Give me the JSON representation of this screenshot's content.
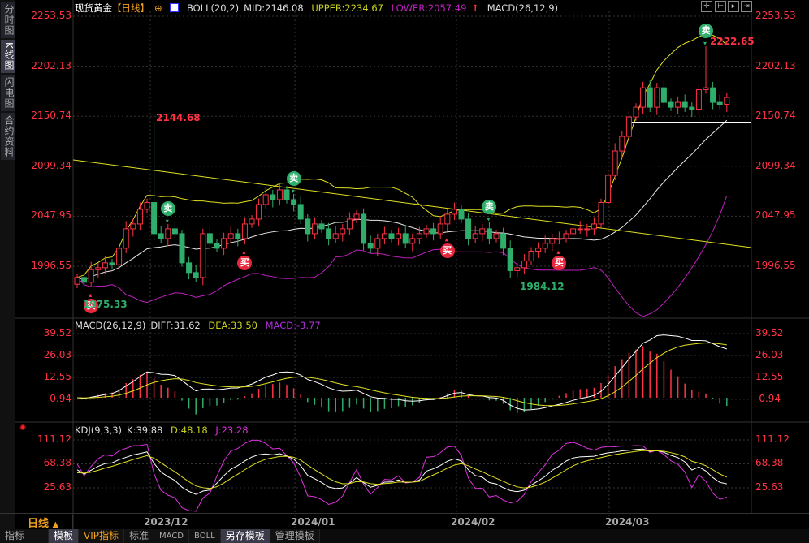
{
  "sidebar": {
    "tabs": [
      {
        "label": "分时图"
      },
      {
        "label": "K线图"
      },
      {
        "label": "闪电图"
      },
      {
        "label": "合约资料"
      }
    ]
  },
  "header": {
    "symbol": "现货黄金",
    "period": "【日线】",
    "boll": "BOLL(20,2)",
    "mid": "MID:2146.08",
    "upper": "UPPER:2234.67",
    "lower": "LOWER:2057.49",
    "macd": "MACD(26,12,9)"
  },
  "macd_legend": {
    "name": "MACD(26,12,9)",
    "diff": "DIFF:31.62",
    "dea": "DEA:33.50",
    "macd": "MACD:-3.77"
  },
  "kdj_legend": {
    "name": "KDJ(9,3,3)",
    "k": "K:39.88",
    "d": "D:48.18",
    "j": "J:23.28"
  },
  "toolbar": {
    "icons": [
      "crosshair-icon",
      "zoom-in-icon",
      "zoom-out-icon",
      "move-right-icon"
    ]
  },
  "annotations": {
    "high": "2144.68",
    "low_start": "1975.33",
    "low_feb": "1984.12",
    "high_mar": "2222.65",
    "sell": "卖",
    "buy": "买"
  },
  "colors": {
    "up": "#ff3344",
    "down": "#2fae6b",
    "boll": "#e0e020",
    "mid": "#e8e8e8",
    "lower": "#c020c0"
  },
  "bottom": {
    "period": "日线",
    "period_icon": "▲",
    "tabs": [
      "指标",
      "模板",
      "VIP指标",
      "标准",
      "MACD",
      "BOLL",
      "另存模板",
      "管理模板"
    ]
  },
  "chart_data": {
    "type": "candlestick",
    "x_ticks": [
      "2023/12",
      "2024/01",
      "2024/02",
      "2024/03"
    ],
    "price_axis": [
      "2253.53",
      "2202.13",
      "2150.74",
      "2099.34",
      "2047.95",
      "1996.55"
    ],
    "macd_axis": [
      "39.52",
      "26.03",
      "12.55",
      "-0.94"
    ],
    "kdj_axis": [
      "111.12",
      "68.38",
      "25.63"
    ],
    "closes": [
      1985,
      1980,
      1993,
      1995,
      2000,
      1998,
      2015,
      2035,
      2040,
      2055,
      2062,
      2030,
      2025,
      2035,
      2030,
      2000,
      1990,
      1985,
      2030,
      2020,
      2015,
      2025,
      2030,
      2025,
      2040,
      2045,
      2060,
      2070,
      2065,
      2075,
      2065,
      2060,
      2045,
      2030,
      2040,
      2035,
      2025,
      2030,
      2035,
      2045,
      2050,
      2020,
      2015,
      2025,
      2030,
      2025,
      2030,
      2020,
      2025,
      2030,
      2035,
      2030,
      2040,
      2050,
      2055,
      2045,
      2025,
      2030,
      2035,
      2025,
      2030,
      2015,
      1992,
      1995,
      2002,
      2012,
      2015,
      2020,
      2025,
      2025,
      2030,
      2035,
      2035,
      2035,
      2040,
      2062,
      2090,
      2115,
      2130,
      2150,
      2160,
      2180,
      2160,
      2180,
      2165,
      2160,
      2165,
      2160,
      2158,
      2178,
      2180,
      2165,
      2163,
      2170
    ],
    "first_open": 1978,
    "sell_signals": [
      13,
      31,
      59,
      90
    ],
    "buy_signals": [
      2,
      24,
      53,
      69
    ]
  }
}
